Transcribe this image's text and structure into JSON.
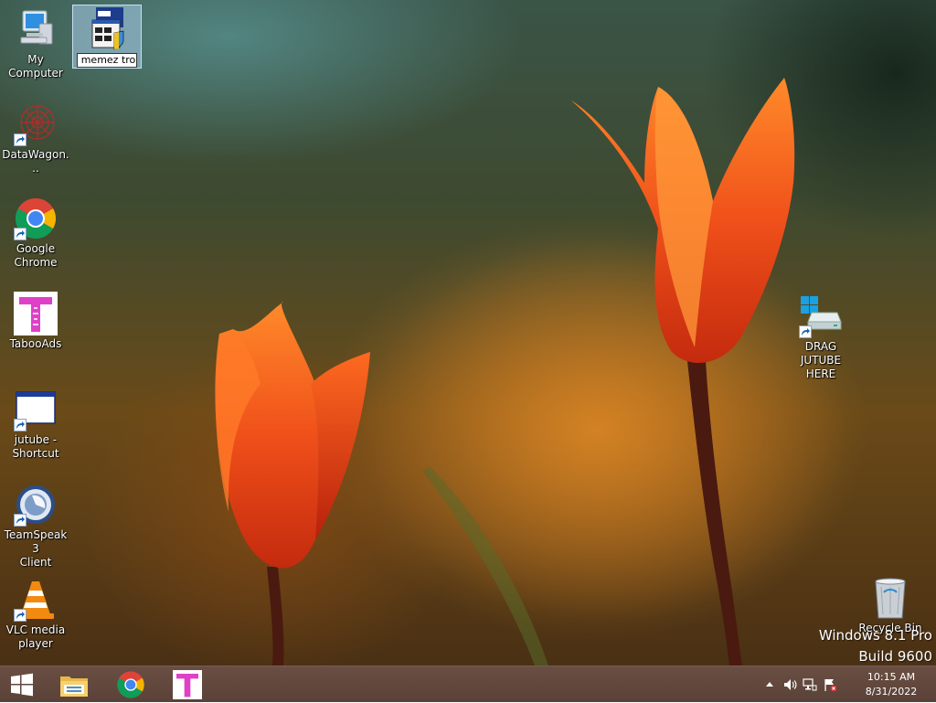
{
  "desktop": {
    "icons": {
      "my_computer": {
        "label": "My Computer"
      },
      "memez": {
        "rename_value": "memez tro"
      },
      "datawagon": {
        "label": "DataWagon..."
      },
      "chrome": {
        "label_line1": "Google",
        "label_line2": "Chrome"
      },
      "tabooads": {
        "label": "TabooAds",
        "glyph": "T"
      },
      "jutube": {
        "label_line1": "jutube -",
        "label_line2": "Shortcut"
      },
      "teamspeak": {
        "label_line1": "TeamSpeak 3",
        "label_line2": "Client"
      },
      "vlc": {
        "label_line1": "VLC media",
        "label_line2": "player"
      },
      "drag_jutube": {
        "label_line1": "DRAG JUTUBE",
        "label_line2": "HERE"
      },
      "recycle_bin": {
        "label": "Recycle Bin"
      }
    },
    "watermark": {
      "line1": "Windows 8.1 Pro",
      "line2": "Build 9600"
    }
  },
  "taskbar": {
    "pinned": [
      "start-button",
      "file-explorer",
      "google-chrome",
      "tabooads"
    ],
    "tabooads_glyph": "T",
    "tray": {
      "icons": [
        "show-hidden-icons",
        "volume-icon",
        "network-icon",
        "action-center-flag-icon"
      ]
    },
    "clock": {
      "time": "10:15 AM",
      "date": "8/31/2022"
    }
  },
  "colors": {
    "taskbar": "#5e463b",
    "tabooads_pink": "#e040c8",
    "windows_blue": "#1ba1e2"
  }
}
